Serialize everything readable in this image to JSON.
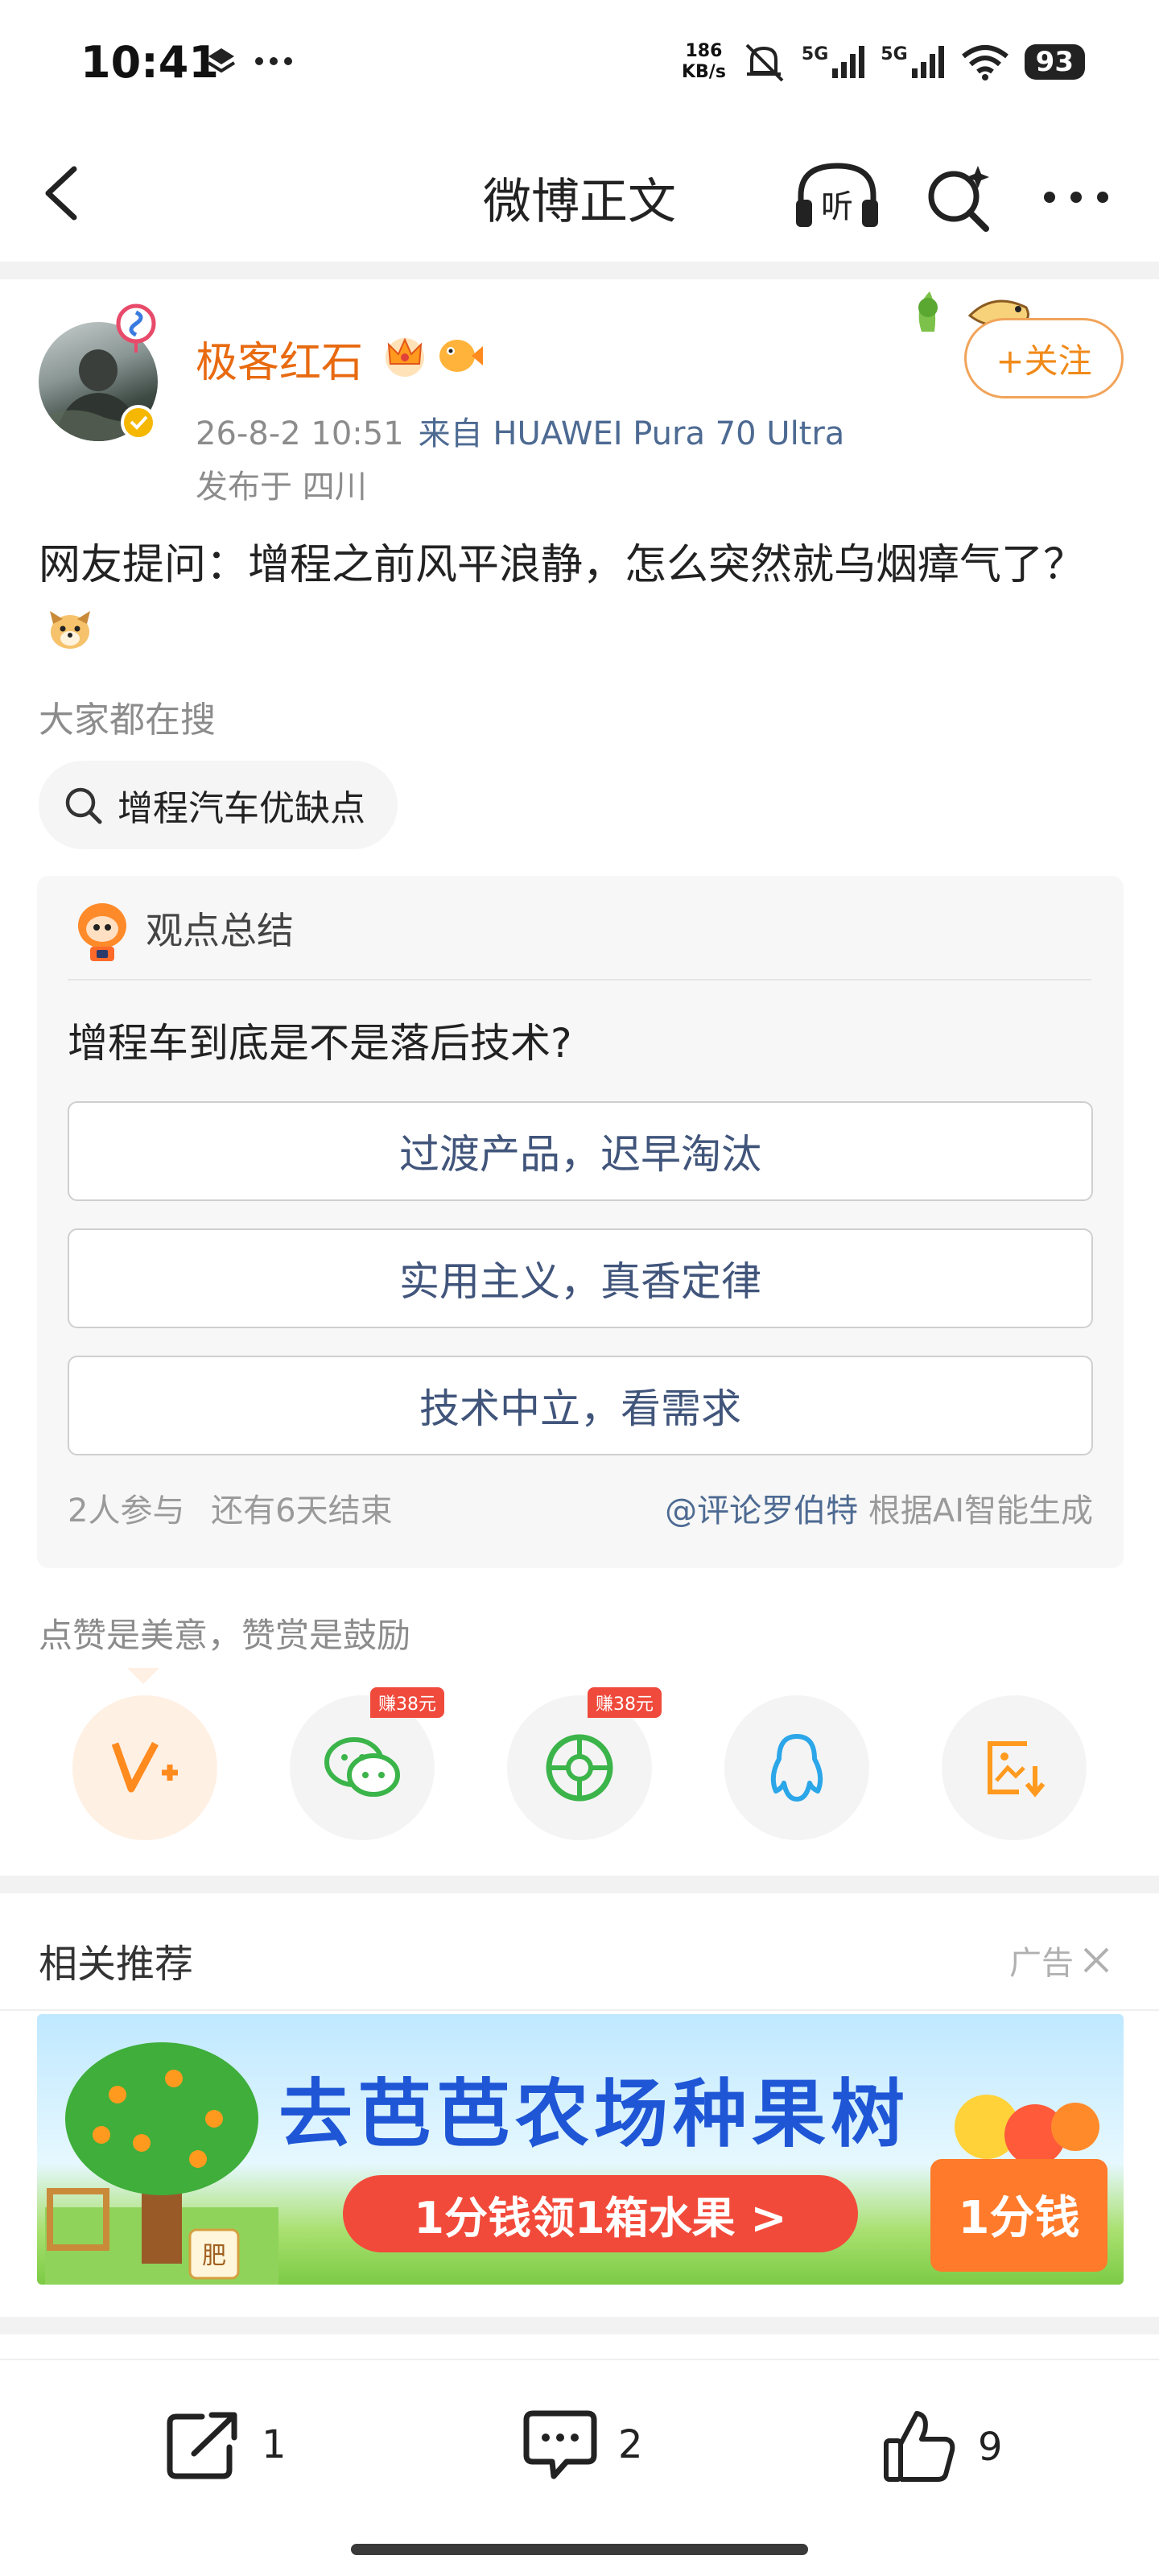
{
  "status_bar": {
    "time": "10:41",
    "net_speed_value": "186",
    "net_speed_unit": "KB/s",
    "signal_1": "5G",
    "signal_2": "5G",
    "battery": "93"
  },
  "nav": {
    "title": "微博正文",
    "listen_label": "听"
  },
  "post": {
    "author": "极客红石",
    "date": "26-8-2 10:51",
    "source": "来自 HUAWEI Pura 70 Ultra",
    "location": "发布于 四川",
    "follow_label": "+关注",
    "text": "网友提问：增程之前风平浪静，怎么突然就乌烟瘴气了？",
    "search_hint": "大家都在搜",
    "search_chip": "增程汽车优缺点"
  },
  "poll": {
    "header": "观点总结",
    "question": "增程车到底是不是落后技术?",
    "options": [
      "过渡产品，迟早淘汰",
      "实用主义，真香定律",
      "技术中立，看需求"
    ],
    "participants": "2人参与",
    "deadline": "还有6天结束",
    "mention": "@评论罗伯特",
    "generated_by": "根据AI智能生成"
  },
  "share": {
    "reward_hint": "点赞是美意，赞赏是鼓励",
    "earn_badge": "赚38元"
  },
  "related": {
    "title": "相关推荐",
    "ad_label": "广告",
    "ad_headline": "去芭芭农场种果树",
    "ad_pill": "1分钱领1箱水果 >",
    "ad_box_label": "1分钱",
    "ad_tree_label": "肥"
  },
  "bottom_bar": {
    "repost_count": "1",
    "comment_count": "2",
    "like_count": "9"
  },
  "colors": {
    "accent_orange": "#e86a10",
    "link_blue": "#4d6a92",
    "poll_option_text": "#41557b",
    "ad_headline": "#1f56d6"
  }
}
